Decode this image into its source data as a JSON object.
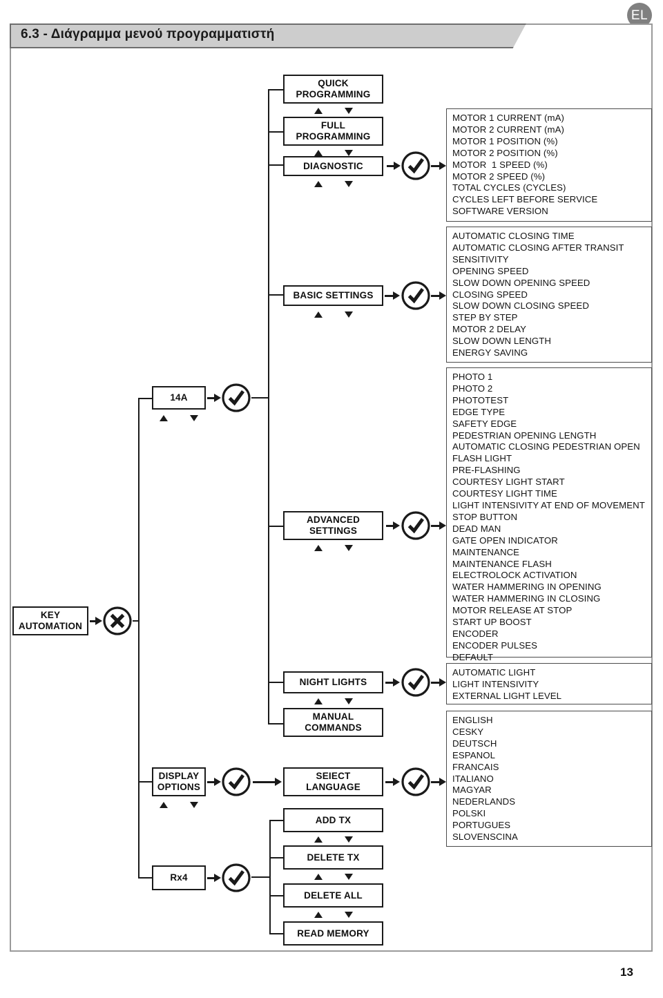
{
  "header": {
    "language_badge": "EL",
    "section_title": "6.3 - Διάγραμμα μενού προγραμματιστή",
    "page_number": "13"
  },
  "icons": {
    "confirm": "check-circle-icon",
    "cancel": "x-circle-icon",
    "scroll_up": "triangle-up-icon",
    "scroll_down": "triangle-down-icon",
    "flow_arrow": "arrow-right-icon"
  },
  "nodes": {
    "key_automation": {
      "line1": "KEY",
      "line2": "AUTOMATION"
    },
    "model_14a": {
      "line1": "14A",
      "line2": ""
    },
    "display_options": {
      "line1": "DISPLAY",
      "line2": "OPTIONS"
    },
    "rx4": {
      "line1": "Rx4",
      "line2": ""
    },
    "quick_programming": {
      "line1": "QUICK",
      "line2": "PROGRAMMING"
    },
    "full_programming": {
      "line1": "FULL",
      "line2": "PROGRAMMING"
    },
    "diagnostic": {
      "line1": "DIAGNOSTIC",
      "line2": ""
    },
    "basic_settings": {
      "line1": "BASIC SETTINGS",
      "line2": ""
    },
    "advanced_settings": {
      "line1": "ADVANCED",
      "line2": "SETTINGS"
    },
    "night_lights": {
      "line1": "NIGHT LIGHTS",
      "line2": ""
    },
    "manual_commands": {
      "line1": "MANUAL",
      "line2": "COMMANDS"
    },
    "select_language": {
      "line1": "SEIECT",
      "line2": "LANGUAGE"
    },
    "add_tx": {
      "line1": "ADD TX",
      "line2": ""
    },
    "delete_tx": {
      "line1": "DELETE TX",
      "line2": ""
    },
    "delete_all": {
      "line1": "DELETE ALL",
      "line2": ""
    },
    "read_memory": {
      "line1": "READ MEMORY",
      "line2": ""
    }
  },
  "lists": {
    "diagnostic_items": [
      "MOTOR 1 CURRENT (mA)",
      "MOTOR 2 CURRENT (mA)",
      "MOTOR 1 POSITION (%)",
      "MOTOR 2 POSITION (%)",
      "MOTOR  1 SPEED (%)",
      "MOTOR 2 SPEED (%)",
      "TOTAL CYCLES (CYCLES)",
      "CYCLES LEFT BEFORE SERVICE",
      "SOFTWARE VERSION"
    ],
    "basic_settings_items": [
      "AUTOMATIC CLOSING TIME",
      "AUTOMATIC CLOSING AFTER TRANSIT",
      "SENSITIVITY",
      "OPENING SPEED",
      "SLOW DOWN OPENING SPEED",
      "CLOSING SPEED",
      "SLOW DOWN CLOSING SPEED",
      "STEP BY STEP",
      "MOTOR 2 DELAY",
      "SLOW DOWN LENGTH",
      "ENERGY SAVING"
    ],
    "advanced_settings_items": [
      "PHOTO 1",
      "PHOTO 2",
      "PHOTOTEST",
      "EDGE TYPE",
      "SAFETY EDGE",
      "PEDESTRIAN OPENING LENGTH",
      "AUTOMATIC CLOSING PEDESTRIAN OPEN",
      "FLASH LIGHT",
      "PRE-FLASHING",
      "COURTESY LIGHT START",
      "COURTESY LIGHT TIME",
      "LIGHT INTENSIVITY AT END OF MOVEMENT",
      "STOP BUTTON",
      "DEAD MAN",
      "GATE OPEN INDICATOR",
      "MAINTENANCE",
      "MAINTENANCE FLASH",
      "ELECTROLOCK ACTIVATION",
      "WATER HAMMERING IN OPENING",
      "WATER HAMMERING IN CLOSING",
      "MOTOR RELEASE AT STOP",
      "START UP BOOST",
      "ENCODER",
      "ENCODER PULSES",
      "DEFAULT"
    ],
    "night_lights_items": [
      "AUTOMATIC LIGHT",
      "LIGHT INTENSIVITY",
      "EXTERNAL LIGHT LEVEL"
    ],
    "language_items": [
      "ENGLISH",
      "CESKY",
      "DEUTSCH",
      "ESPANOL",
      "FRANCAIS",
      "ITALIANO",
      "MAGYAR",
      "NEDERLANDS",
      "POLSKI",
      "PORTUGUES",
      "SLOVENSCINA"
    ]
  },
  "colors": {
    "title_bar": "#cdcdcd",
    "badge": "#808080",
    "frame": "#9a9a9a",
    "ink": "#1a1a1a"
  }
}
